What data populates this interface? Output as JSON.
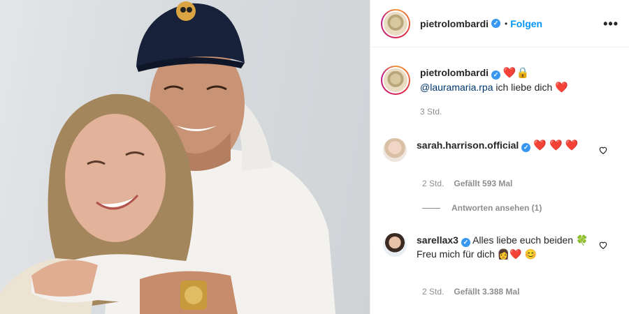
{
  "post": {
    "author": "pietrolombardi",
    "follow_label": "Folgen",
    "dot": "•",
    "more": "•••"
  },
  "caption": {
    "author": "pietrolombardi",
    "emoji": "❤️🔒",
    "mention": "@lauramaria.rpa",
    "text": " ich liebe dich ",
    "end_emoji": "❤️",
    "time": "3 Std."
  },
  "comments": [
    {
      "author": "sarah.harrison.official",
      "text": "❤️ ❤️ ❤️",
      "time": "2 Std.",
      "likes": "Gefällt 593 Mal",
      "replies": "Antworten ansehen (1)"
    },
    {
      "author": "sarellax3",
      "text": "Alles liebe euch beiden 🍀 Freu mich für dich 👩‍❤️ 😊",
      "time": "2 Std.",
      "likes": "Gefällt 3.388 Mal"
    }
  ],
  "colors": {
    "link": "#0095f6",
    "verified": "#3897f0",
    "heart": "#e0245e"
  }
}
